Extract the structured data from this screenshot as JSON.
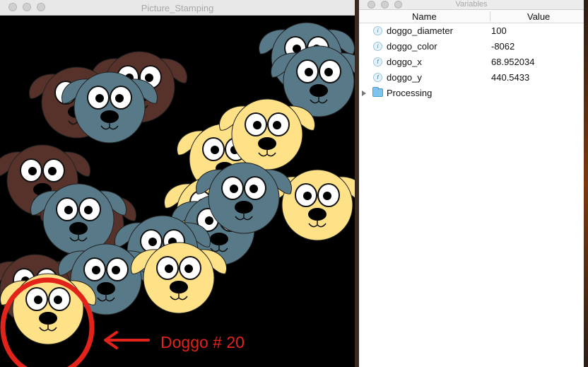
{
  "sketch_window": {
    "title": "Picture_Stamping",
    "annotation": {
      "label": "Doggo # 20",
      "color": "#e2231a"
    },
    "dog_colors": {
      "yellow": "#ffe187",
      "blue_gray": "#587a88",
      "brown": "#57322a"
    }
  },
  "variables_window": {
    "title": "Variables",
    "columns": {
      "name": "Name",
      "value": "Value"
    },
    "rows": [
      {
        "type_icon": "i",
        "name": "doggo_diameter",
        "value": "100"
      },
      {
        "type_icon": "i",
        "name": "doggo_color",
        "value": "-8062"
      },
      {
        "type_icon": "f",
        "name": "doggo_x",
        "value": "68.952034"
      },
      {
        "type_icon": "f",
        "name": "doggo_y",
        "value": "440.5433"
      }
    ],
    "folder": {
      "name": "Processing",
      "expanded": false
    }
  }
}
